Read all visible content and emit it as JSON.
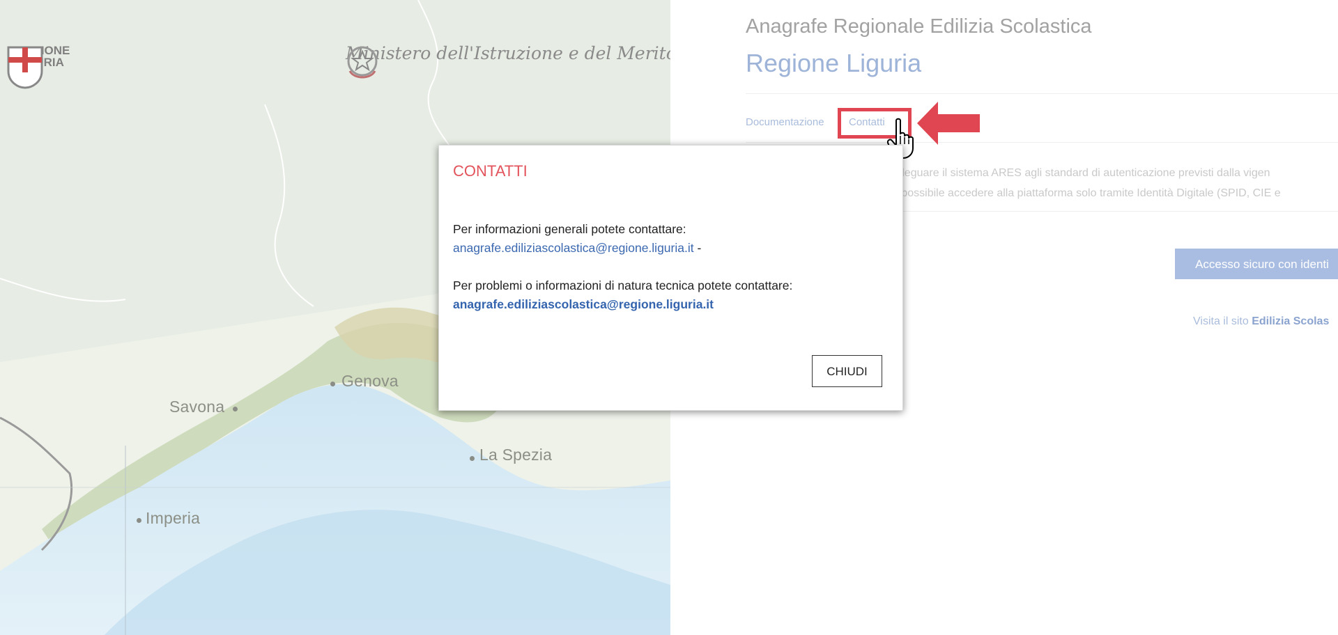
{
  "header": {
    "subtitle": "Anagrafe Regionale Edilizia Scolastica",
    "title": "Regione Liguria"
  },
  "nav": {
    "items": [
      {
        "label": "Documentazione"
      },
      {
        "label": "Contatti"
      }
    ]
  },
  "notice": {
    "line1": "adeguare il sistema ARES agli standard di autenticazione previsti dalla vigen",
    "line2": "è possibile accedere alla piattaforma solo tramite Identità Digitale (SPID, CIE e"
  },
  "login": {
    "spid_button": "Accesso sicuro con identi",
    "visit_prefix": "Visita il sito ",
    "visit_link": "Edilizia Scolas"
  },
  "map": {
    "logo_regione_line1": "REGIONE",
    "logo_regione_line2": "LIGURIA",
    "logo_ministero": "Ministero dell'Istruzione e del Merito",
    "cities": [
      {
        "name": "Genova"
      },
      {
        "name": "Savona"
      },
      {
        "name": "La Spezia"
      },
      {
        "name": "Imperia"
      }
    ]
  },
  "modal": {
    "title": "CONTATTI",
    "general_text": "Per informazioni generali potete contattare:",
    "general_email": "anagrafe.ediliziascolastica@regione.liguria.it",
    "general_suffix": " -",
    "tech_text": "Per problemi o informazioni di natura tecnica potete contattare:",
    "tech_email": "anagrafe.ediliziascolastica@regione.liguria.it",
    "close_label": "CHIUDI"
  },
  "colors": {
    "accent_red": "#e04651",
    "link_blue": "#3b68b0",
    "title_blue": "#9db3d8"
  },
  "icons": [
    "red-arrow-icon",
    "hand-cursor-icon",
    "regione-liguria-shield-icon",
    "italian-republic-emblem-icon"
  ]
}
